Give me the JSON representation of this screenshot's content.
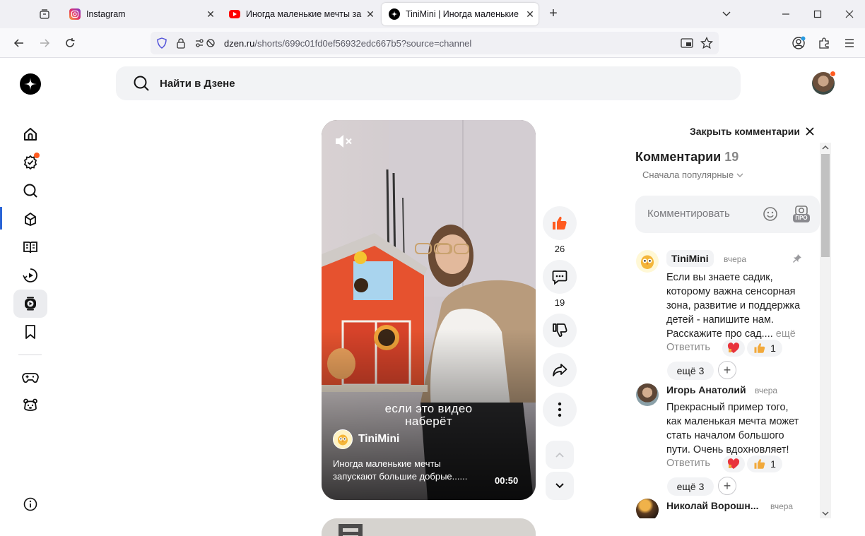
{
  "browser": {
    "tabs": [
      {
        "title": "Instagram",
        "active": false
      },
      {
        "title": "Иногда маленькие мечты запуска",
        "active": false
      },
      {
        "title": "TiniMini | Иногда маленькие м",
        "active": true
      }
    ],
    "url_host": "dzen.ru",
    "url_path": "/shorts/699c01fd0ef56932edc667b5?source=channel"
  },
  "header": {
    "search_placeholder": "Найти в Дзене"
  },
  "sidebar": {
    "items": [
      "home-icon",
      "subscriptions-icon",
      "search-icon",
      "cube-icon",
      "book-icon",
      "video-icon",
      "shorts-icon",
      "bookmark-icon",
      "gamepad-icon",
      "bear-icon",
      "info-icon"
    ]
  },
  "video": {
    "overlay_caption_line1": "если это видео",
    "overlay_caption_line2": "наберёт",
    "channel": "TiniMini",
    "description_line1": "Иногда маленькие мечты",
    "description_line2": "запускают большие добрые......",
    "duration": "00:50"
  },
  "actions": {
    "likes": "26",
    "comments": "19"
  },
  "comments_panel": {
    "close_label": "Закрыть комментарии",
    "title": "Комментарии",
    "count": "19",
    "sort": "Сначала популярные",
    "input_placeholder": "Комментировать",
    "pro_badge": "ПРО",
    "items": [
      {
        "author": "TiniMini",
        "time": "вчера",
        "lines": [
          "Если вы знаете садик,",
          "которому важна сенсорная",
          "зона, развитие и поддержка",
          "детей - напишите нам.",
          "Расскажите про сад...."
        ],
        "more": "ещё",
        "reply": "Ответить",
        "reaction_count": "1",
        "more_replies": "ещё 3"
      },
      {
        "author": "Игорь Анатолий",
        "time": "вчера",
        "lines": [
          "Прекрасный пример того,",
          "как маленькая мечта может",
          "стать началом большого",
          "пути. Очень вдохновляет!"
        ],
        "reply": "Ответить",
        "reaction_count": "1",
        "more_replies": "ещё 3"
      },
      {
        "author": "Николай Ворошн...",
        "time": "вчера"
      }
    ]
  },
  "colors": {
    "accent": "#ff5a1f",
    "panel_bg": "#f2f3f5",
    "text_muted": "#888888"
  }
}
